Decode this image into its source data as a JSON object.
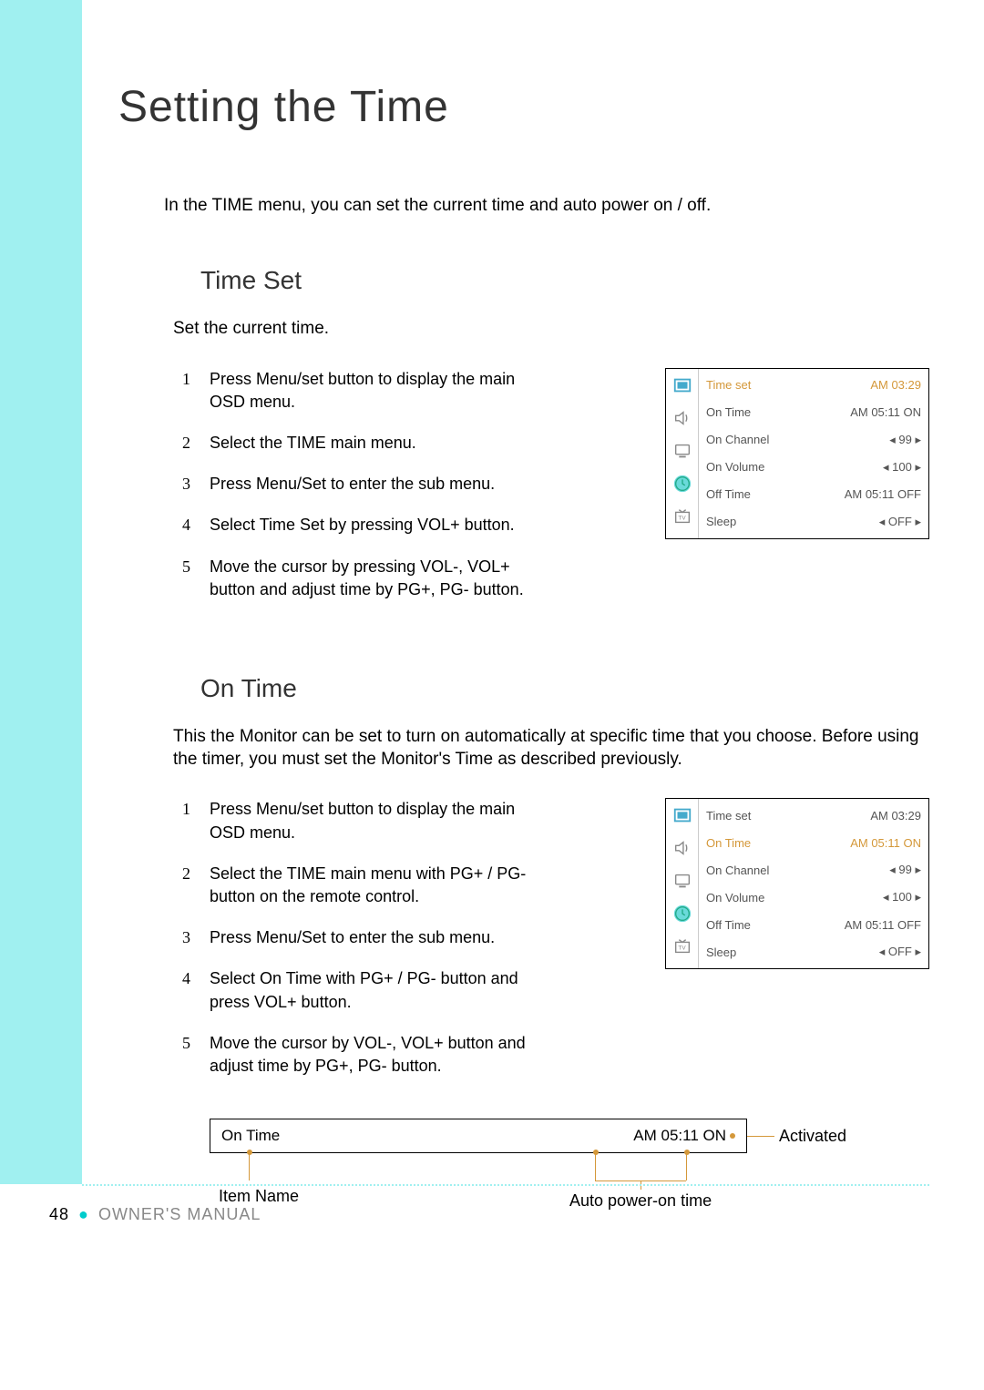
{
  "page_title": "Setting the Time",
  "intro": "In the TIME menu, you can set the current time and auto power on / off.",
  "section1": {
    "heading": "Time Set",
    "desc": "Set the current time.",
    "steps": [
      "Press Menu/set button to display the main OSD menu.",
      "Select the TIME main menu.",
      "Press Menu/Set to enter the sub menu.",
      "Select Time Set by pressing VOL+ button.",
      "Move the cursor by pressing VOL-, VOL+ button and adjust time by PG+, PG- button."
    ],
    "osd": [
      {
        "label": "Time set",
        "value": "AM 03:29",
        "highlight": true
      },
      {
        "label": "On Time",
        "value": "AM 05:11 ON"
      },
      {
        "label": "On Channel",
        "value": "◂ 99 ▸"
      },
      {
        "label": "On Volume",
        "value": "◂ 100 ▸"
      },
      {
        "label": "Off Time",
        "value": "AM 05:11 OFF"
      },
      {
        "label": "Sleep",
        "value": "◂ OFF ▸"
      }
    ]
  },
  "section2": {
    "heading": "On Time",
    "desc": "This the Monitor can be set to turn on automatically at specific time that you choose. Before using the timer, you must set the Monitor's Time as described previously.",
    "steps": [
      "Press Menu/set button to display the main OSD menu.",
      "Select the TIME main menu with PG+ / PG- button on the remote control.",
      "Press Menu/Set to enter the sub menu.",
      "Select On Time with PG+ / PG- button and press VOL+ button.",
      "Move the cursor by VOL-, VOL+ button and adjust time by PG+, PG- button."
    ],
    "osd": [
      {
        "label": "Time set",
        "value": "AM 03:29"
      },
      {
        "label": "On Time",
        "value": "AM 05:11 ON",
        "highlight": true
      },
      {
        "label": "On Channel",
        "value": "◂ 99 ▸"
      },
      {
        "label": "On Volume",
        "value": "◂ 100 ▸"
      },
      {
        "label": "Off Time",
        "value": "AM 05:11 OFF"
      },
      {
        "label": "Sleep",
        "value": "◂ OFF ▸"
      }
    ]
  },
  "diagram": {
    "left_box": "On Time",
    "right_box": "AM 05:11 ON",
    "top_right_label": "Activated",
    "bottom_left_label": "Item Name",
    "bottom_right_label": "Auto power-on time"
  },
  "footer": {
    "page": "48",
    "manual": "OWNER'S MANUAL"
  }
}
